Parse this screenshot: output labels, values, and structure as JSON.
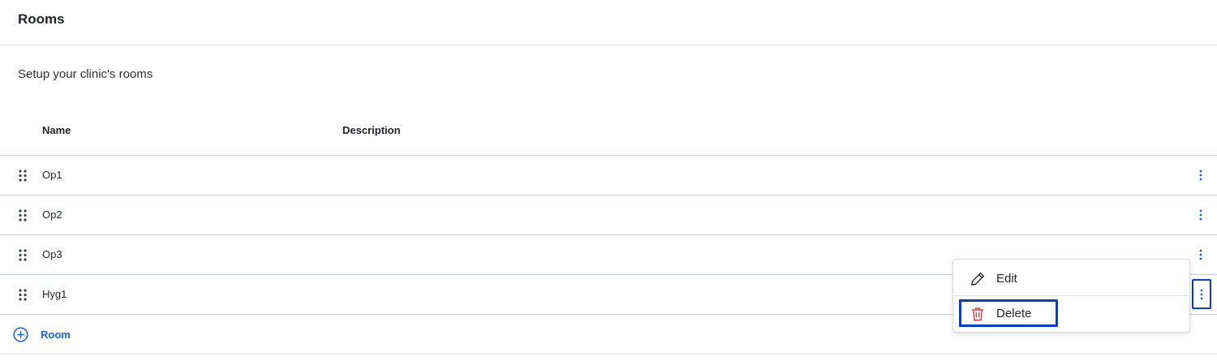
{
  "header": {
    "title": "Rooms"
  },
  "subtitle": "Setup your clinic's rooms",
  "table": {
    "columns": [
      "Name",
      "Description"
    ],
    "rows": [
      {
        "name": "Op1",
        "description": ""
      },
      {
        "name": "Op2",
        "description": ""
      },
      {
        "name": "Op3",
        "description": ""
      },
      {
        "name": "Hyg1",
        "description": ""
      }
    ],
    "add_label": "Room"
  },
  "context_menu": {
    "edit_label": "Edit",
    "delete_label": "Delete"
  },
  "colors": {
    "accent": "#1a5fd1",
    "delete_icon": "#d93a3a",
    "focus_outline": "#0a3ad6",
    "divider": "#c7ccd3"
  },
  "icons": {
    "drag": "drag-handle-icon",
    "row_menu": "more-vertical-icon",
    "add": "plus-circle-icon",
    "edit": "pencil-icon",
    "delete": "trash-icon"
  }
}
